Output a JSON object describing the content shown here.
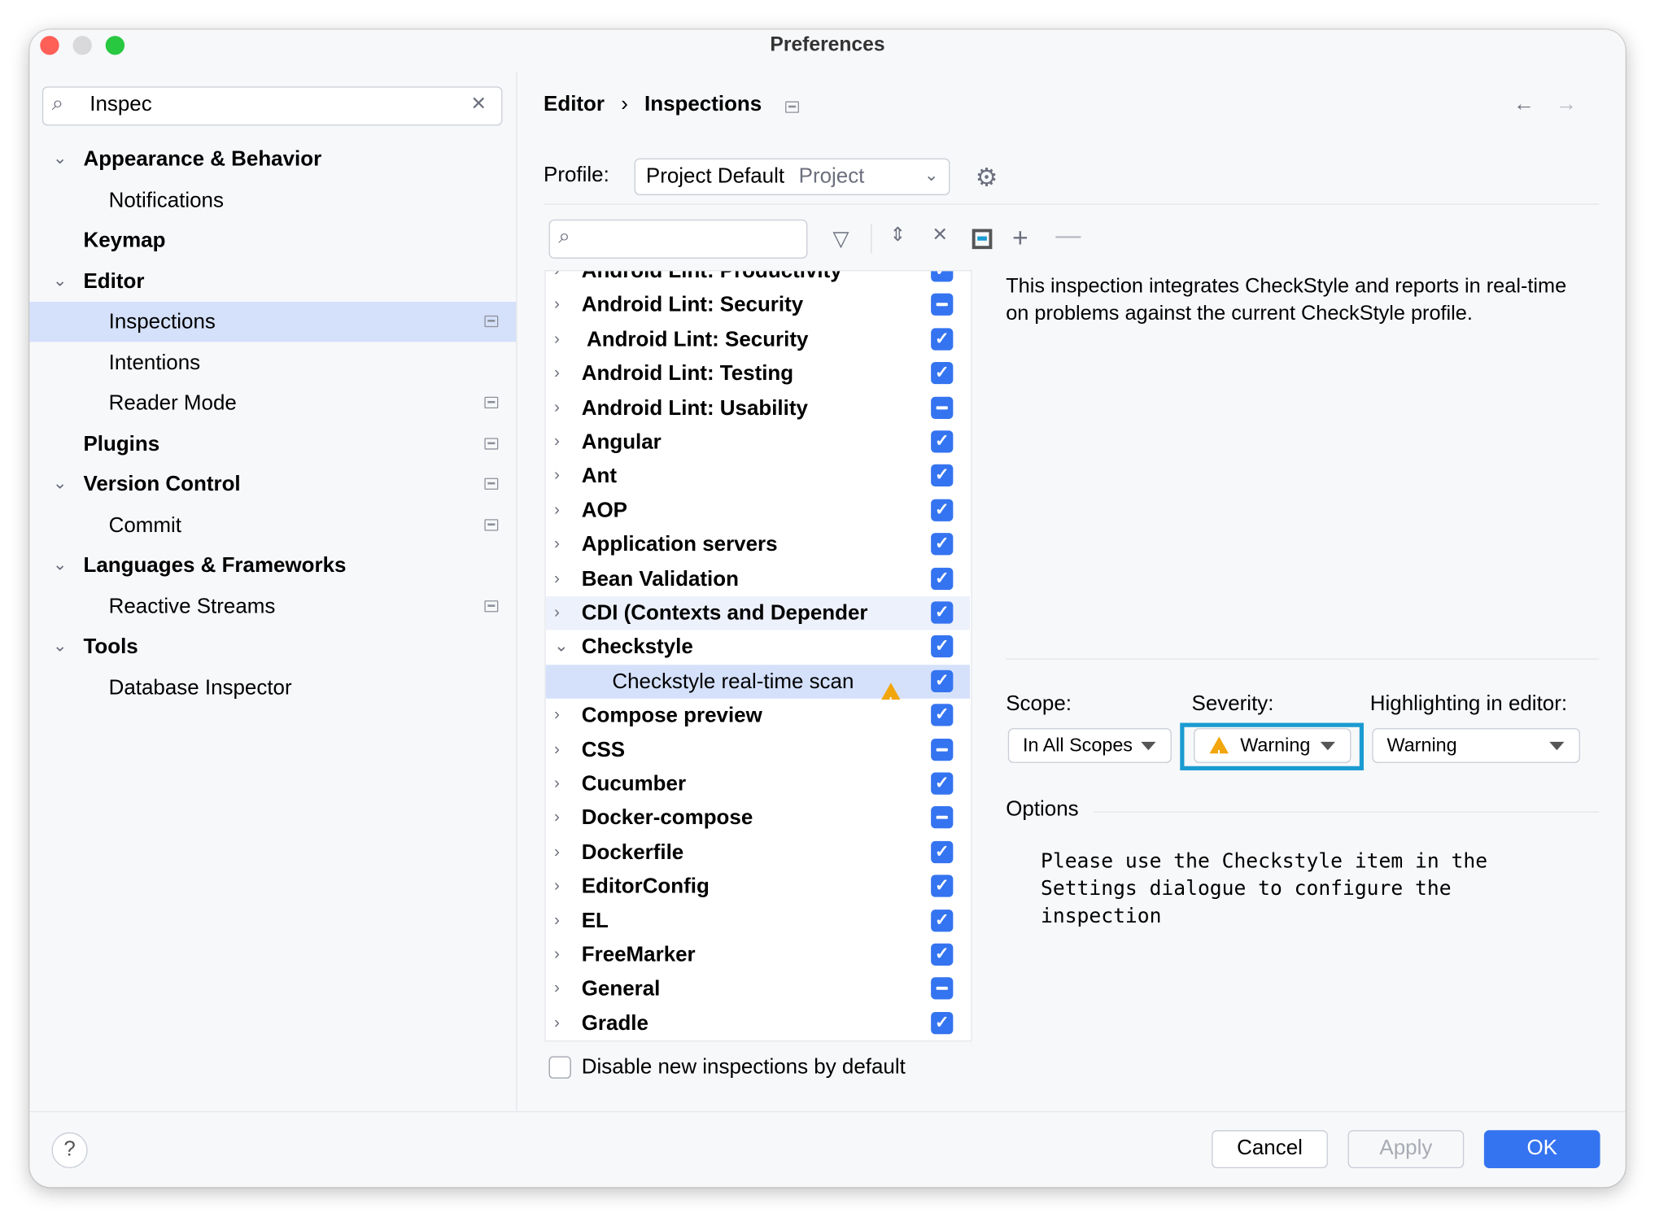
{
  "window": {
    "title": "Preferences"
  },
  "sidebar": {
    "search_value": "Inspec",
    "items": [
      {
        "label": "Appearance & Behavior",
        "level": 0,
        "expanded": true,
        "bold": true
      },
      {
        "label": "Notifications",
        "level": 1
      },
      {
        "label": "Keymap",
        "level": 0,
        "bold": true
      },
      {
        "label": "Editor",
        "level": 0,
        "expanded": true,
        "bold": true
      },
      {
        "label": "Inspections",
        "level": 1,
        "selected": true,
        "badge": true
      },
      {
        "label": "Intentions",
        "level": 1
      },
      {
        "label": "Reader Mode",
        "level": 1,
        "badge": true
      },
      {
        "label": "Plugins",
        "level": 0,
        "bold": true,
        "badge": true
      },
      {
        "label": "Version Control",
        "level": 0,
        "expanded": true,
        "bold": true,
        "badge": true
      },
      {
        "label": "Commit",
        "level": 1,
        "badge": true
      },
      {
        "label": "Languages & Frameworks",
        "level": 0,
        "expanded": true,
        "bold": true
      },
      {
        "label": "Reactive Streams",
        "level": 1,
        "badge": true
      },
      {
        "label": "Tools",
        "level": 0,
        "expanded": true,
        "bold": true
      },
      {
        "label": "Database Inspector",
        "level": 1
      }
    ]
  },
  "breadcrumb": {
    "parent": "Editor",
    "separator": "›",
    "current": "Inspections"
  },
  "profile": {
    "label": "Profile:",
    "value": "Project Default",
    "hint": "Project"
  },
  "tree": {
    "items": [
      {
        "label": "Android Lint: Productivity",
        "state": "checked"
      },
      {
        "label": "Android Lint: Security",
        "state": "partial"
      },
      {
        "label": " Android Lint: Security",
        "state": "checked"
      },
      {
        "label": "Android Lint: Testing",
        "state": "checked"
      },
      {
        "label": "Android Lint: Usability",
        "state": "partial"
      },
      {
        "label": "Angular",
        "state": "checked"
      },
      {
        "label": "Ant",
        "state": "checked"
      },
      {
        "label": "AOP",
        "state": "checked"
      },
      {
        "label": "Application servers",
        "state": "checked"
      },
      {
        "label": "Bean Validation",
        "state": "checked"
      },
      {
        "label": "CDI (Contexts and Depender",
        "state": "checked",
        "hover": true
      },
      {
        "label": "Checkstyle",
        "state": "checked",
        "expanded": true
      },
      {
        "label": "Checkstyle real-time scan",
        "state": "checked",
        "child": true,
        "selected": true,
        "warning": true
      },
      {
        "label": "Compose preview",
        "state": "checked"
      },
      {
        "label": "CSS",
        "state": "partial"
      },
      {
        "label": "Cucumber",
        "state": "checked"
      },
      {
        "label": "Docker-compose",
        "state": "partial"
      },
      {
        "label": "Dockerfile",
        "state": "checked"
      },
      {
        "label": "EditorConfig",
        "state": "checked"
      },
      {
        "label": "EL",
        "state": "checked"
      },
      {
        "label": "FreeMarker",
        "state": "checked"
      },
      {
        "label": "General",
        "state": "partial"
      },
      {
        "label": "Gradle",
        "state": "checked"
      }
    ]
  },
  "disable_new": {
    "label": "Disable new inspections by default",
    "checked": false
  },
  "description": "This inspection integrates CheckStyle and reports in real-time on problems against the current CheckStyle profile.",
  "scope": {
    "label": "Scope:",
    "value": "In All Scopes"
  },
  "severity": {
    "label": "Severity:",
    "value": "Warning"
  },
  "highlighting": {
    "label": "Highlighting in editor:",
    "value": "Warning"
  },
  "options": {
    "title": "Options",
    "lines": [
      "Please use the Checkstyle item in the",
      "Settings dialogue to configure the",
      "inspection"
    ]
  },
  "buttons": {
    "cancel": "Cancel",
    "apply": "Apply",
    "ok": "OK",
    "help": "?"
  },
  "colors": {
    "accent": "#3574f0",
    "selection": "#d5e1fb",
    "focus_ring": "#1a9bd1",
    "warning": "#f2a60d"
  }
}
